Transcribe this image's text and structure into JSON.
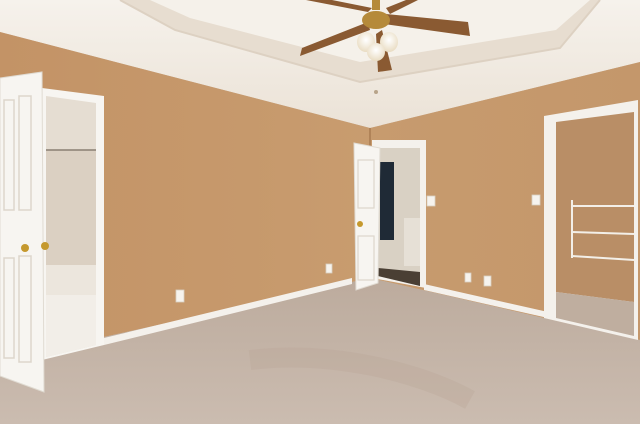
{
  "scene": {
    "colors": {
      "wall_left": "#c79a6c",
      "wall_right": "#c99d70",
      "ceiling": "#f3ede6",
      "tray_ceiling": "#ece4da",
      "carpet": "#c6b6a9",
      "trim": "#f4f1ec",
      "door": "#f7f5f1",
      "closet_wall": "#b98e66",
      "bathroom": "#e9e3da",
      "fan_blade": "#8a5a32",
      "fan_metal": "#b58a3a",
      "light_glass": "#fbf6ea"
    },
    "objects": [
      "ceiling-fan",
      "tray-ceiling",
      "left-open-door",
      "bathroom-view",
      "center-open-door",
      "hallway-view",
      "right-closet-opening",
      "wire-shelves",
      "light-switch",
      "electrical-outlet",
      "baseboard",
      "carpet-floor"
    ]
  }
}
